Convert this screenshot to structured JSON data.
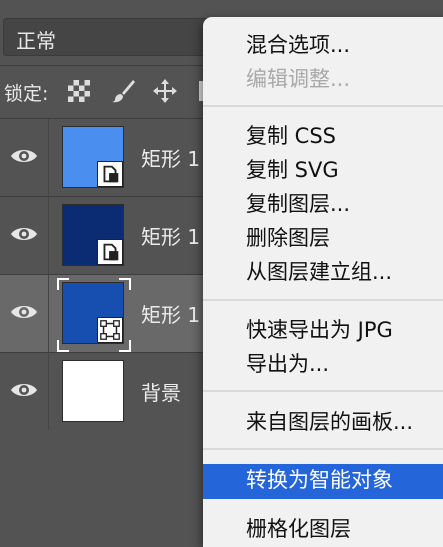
{
  "blend_mode": {
    "value": "正常"
  },
  "lock": {
    "label": "锁定:"
  },
  "layers": [
    {
      "name": "矩形 1",
      "color": "#4a8ef0",
      "selected": false
    },
    {
      "name": "矩形 1",
      "color": "#0b2c73",
      "selected": false
    },
    {
      "name": "矩形 1",
      "color": "#174fb0",
      "selected": true
    },
    {
      "name": "背景",
      "color": "#ffffff",
      "selected": false
    }
  ],
  "context_menu": {
    "items": [
      {
        "label": "混合选项...",
        "enabled": true
      },
      {
        "label": "编辑调整...",
        "enabled": false
      },
      {
        "label": "复制 CSS",
        "enabled": true
      },
      {
        "label": "复制 SVG",
        "enabled": true
      },
      {
        "label": "复制图层...",
        "enabled": true
      },
      {
        "label": "删除图层",
        "enabled": true
      },
      {
        "label": "从图层建立组...",
        "enabled": true
      },
      {
        "label": "快速导出为 JPG",
        "enabled": true
      },
      {
        "label": "导出为...",
        "enabled": true
      },
      {
        "label": "来自图层的画板...",
        "enabled": true
      },
      {
        "label": "转换为智能对象",
        "enabled": true,
        "highlighted": true
      },
      {
        "label": "栅格化图层",
        "enabled": true
      }
    ]
  },
  "colors": {
    "panel_bg": "#535353",
    "selected_row": "#696969",
    "menu_highlight": "#2466d9"
  }
}
